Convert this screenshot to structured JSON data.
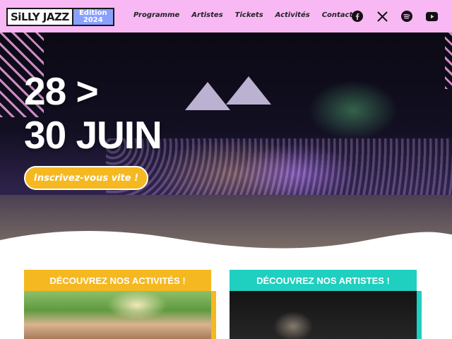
{
  "header": {
    "logo": {
      "main": "SiLLY JAZZ",
      "edition_line1": "Edition",
      "edition_line2": "2024"
    },
    "nav": [
      {
        "label": "Programme"
      },
      {
        "label": "Artistes"
      },
      {
        "label": "Tickets"
      },
      {
        "label": "Activités"
      },
      {
        "label": "Contact"
      }
    ],
    "socials": [
      {
        "icon": "facebook-icon"
      },
      {
        "icon": "x-icon"
      },
      {
        "icon": "spotify-icon"
      },
      {
        "icon": "youtube-icon"
      }
    ]
  },
  "hero": {
    "title_line1": "28 >",
    "title_line2": "30 JUIN",
    "cta_label": "Inscrivez-vous vite !"
  },
  "cards": [
    {
      "title": "DÉCOUVREZ NOS ACTIVITÉS !",
      "color": "#f5b820"
    },
    {
      "title": "DÉCOUVREZ NOS ARTISTES !",
      "color": "#1fcfbf"
    }
  ],
  "colors": {
    "header_bg": "#f8b8f4",
    "accent_yellow": "#f5b820",
    "accent_teal": "#1fcfbf",
    "edition_blue": "#8aa0ff"
  }
}
